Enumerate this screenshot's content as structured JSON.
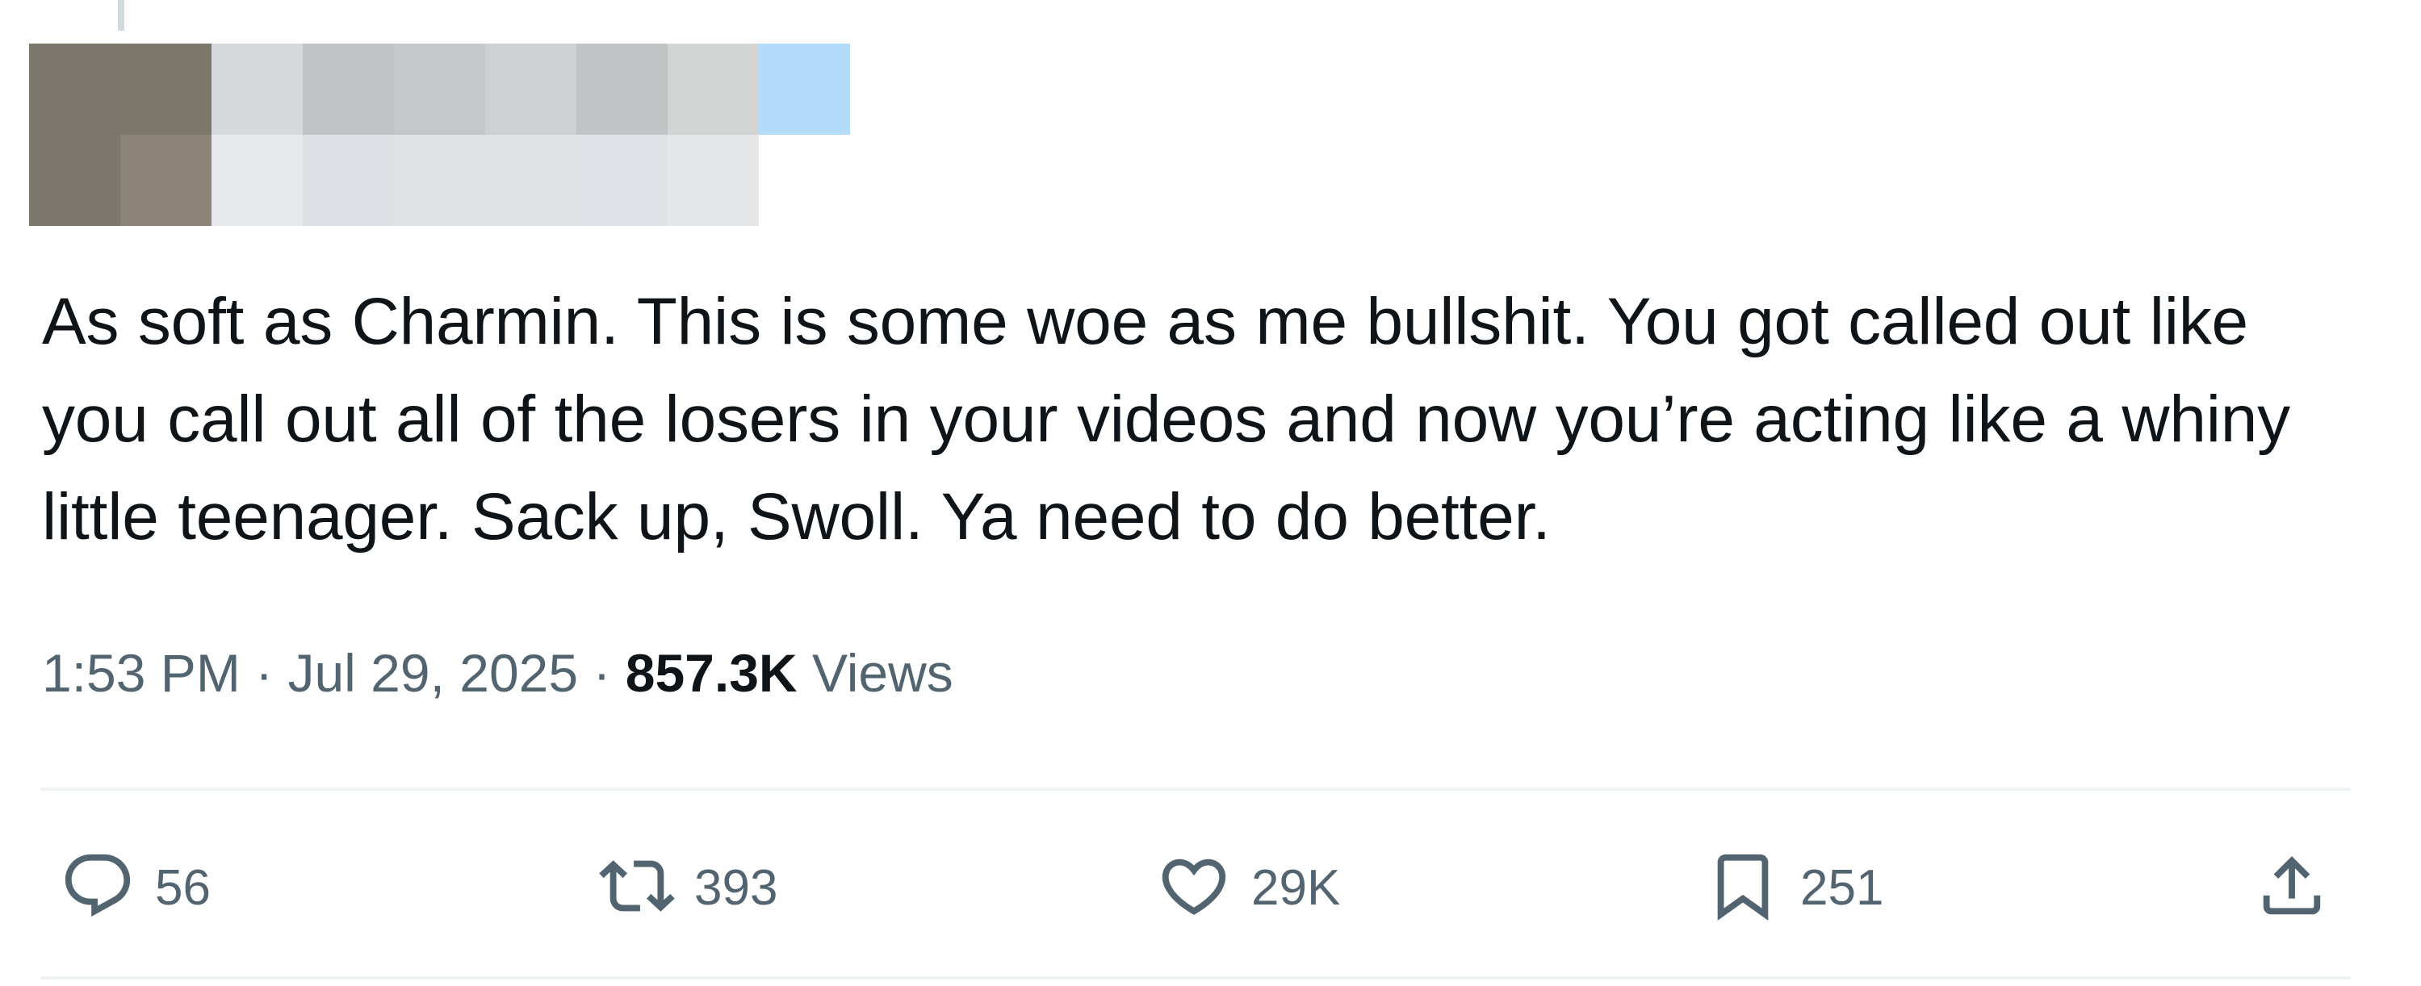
{
  "tweet": {
    "text": "As soft as Charmin. This is some woe as me bullshit. You got called out like you call out all of the losers in your videos and now you’re acting like a whiny little teenager. Sack up, Swoll. Ya need to do better.",
    "time": "1:53 PM",
    "separator": "·",
    "date": "Jul 29, 2025",
    "views_count": "857.3K",
    "views_label": "Views"
  },
  "actions": {
    "replies": "56",
    "reposts": "393",
    "likes": "29K",
    "bookmarks": "251"
  },
  "colors": {
    "text": "#0f1419",
    "secondary": "#536471",
    "divider": "#eff3f4",
    "mosaic": [
      [
        "#7c776d",
        "#7e776b",
        "#d6d8dc",
        "#c2c3c5",
        "#c6c7c9",
        "#cfd0d1",
        "#c2c3c5",
        "#d3d4d4",
        "#b2dcfa"
      ],
      [
        "#7c786e",
        "#8c8478",
        "#e6e8ec",
        "#dde1e5",
        "#dfe2e5",
        "#e0e3e6",
        "#dfe2e6",
        "#e4e6e8",
        "#ffffff"
      ]
    ]
  },
  "icons": {
    "reply": "speech-bubble-icon",
    "repost": "repost-arrows-icon",
    "like": "heart-icon",
    "bookmark": "bookmark-icon",
    "share": "share-upload-icon"
  }
}
